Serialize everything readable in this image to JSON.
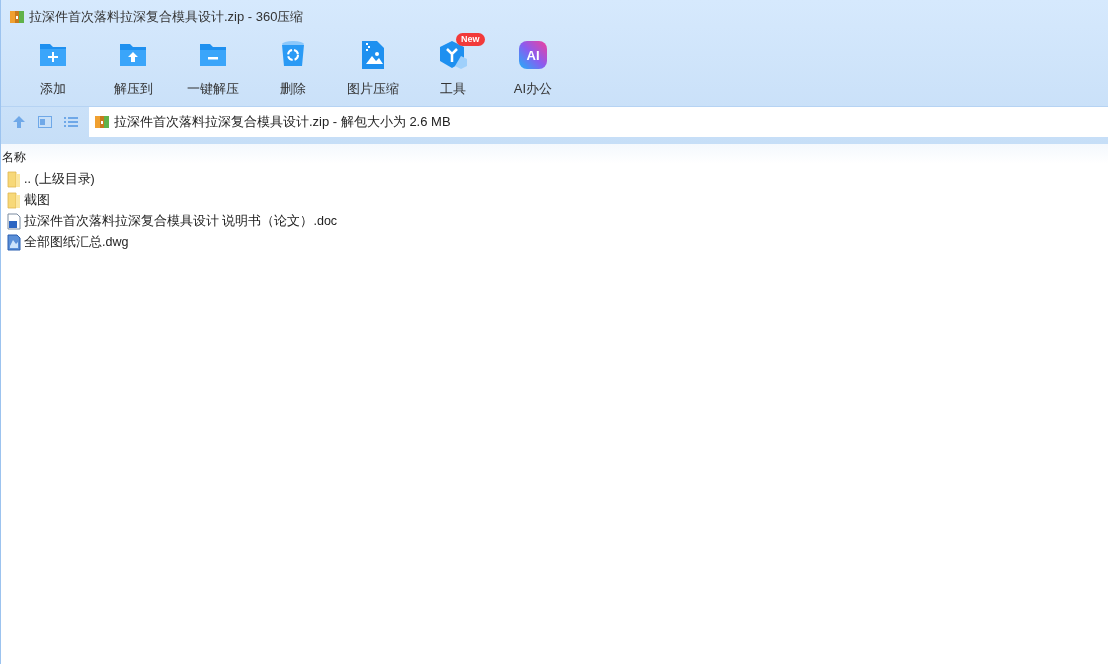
{
  "window": {
    "title": "拉深件首次落料拉深复合模具设计.zip - 360压缩"
  },
  "toolbar": [
    {
      "label": "添加",
      "kind": "add"
    },
    {
      "label": "解压到",
      "kind": "extract"
    },
    {
      "label": "一键解压",
      "kind": "oneclick"
    },
    {
      "label": "删除",
      "kind": "delete"
    },
    {
      "label": "图片压缩",
      "kind": "image"
    },
    {
      "label": "工具",
      "kind": "tools",
      "badge": "New"
    },
    {
      "label": "AI办公",
      "kind": "ai",
      "icon_text": "AI"
    }
  ],
  "address_bar": {
    "text": "拉深件首次落料拉深复合模具设计.zip - 解包大小为 2.6 MB"
  },
  "file_list": {
    "columns": [
      "名称"
    ],
    "rows": [
      {
        "name": ".. (上级目录)",
        "kind": "folder"
      },
      {
        "name": "截图",
        "kind": "folder"
      },
      {
        "name": "拉深件首次落料拉深复合模具设计 说明书（论文）.doc",
        "kind": "doc"
      },
      {
        "name": "全部图纸汇总.dwg",
        "kind": "dwg"
      }
    ]
  }
}
